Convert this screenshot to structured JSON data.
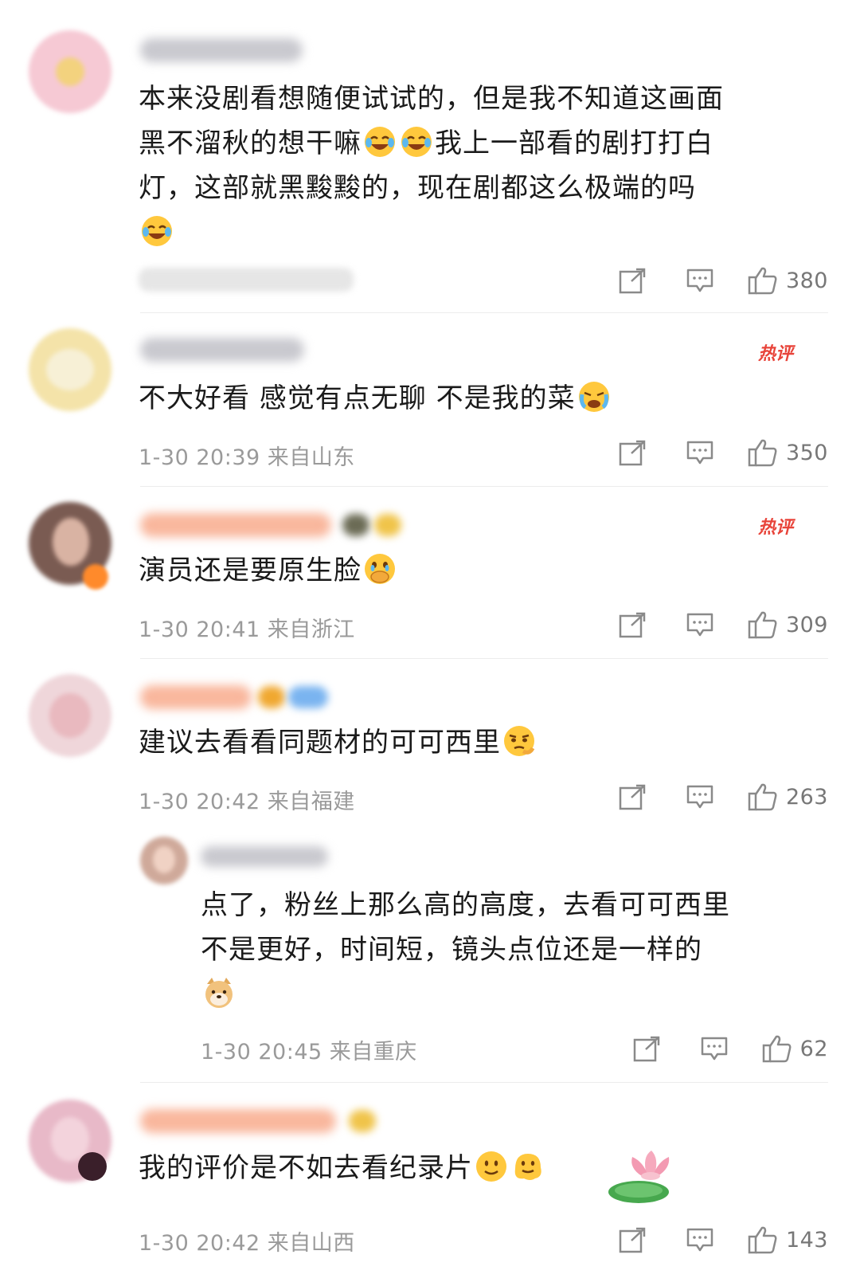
{
  "actions": {
    "share": "share-icon",
    "reply": "comment-icon",
    "like": "thumbs-up-icon"
  },
  "hot_label": "热评",
  "comments": [
    {
      "text_lines": [
        "本来没剧看想随便试试的，但是我不知道这画面",
        "黑不溜秋的想干嘛",
        "我上一部看的剧打打白",
        "灯，这部就黑黢黢的，现在剧都这么极端的吗"
      ],
      "meta": "",
      "likes": "380"
    },
    {
      "text": "不大好看 感觉有点无聊 不是我的菜",
      "meta": "1-30 20:39 来自山东",
      "likes": "350",
      "hot": true
    },
    {
      "text": "演员还是要原生脸",
      "meta": "1-30 20:41 来自浙江",
      "likes": "309",
      "hot": true
    },
    {
      "text": "建议去看看同题材的可可西里",
      "meta": "1-30 20:42 来自福建",
      "likes": "263"
    },
    {
      "reply": true,
      "text_lines": [
        "点了，粉丝上那么高的高度，去看可可西里",
        "不是更好，时间短，镜头点位还是一样的"
      ],
      "meta": "1-30 20:45 来自重庆",
      "likes": "62"
    },
    {
      "text": "我的评价是不如去看纪录片",
      "meta": "1-30 20:42 来自山西",
      "likes": "143"
    }
  ],
  "colors": {
    "hot": "#e8443a",
    "meta": "#9a9a9a",
    "text": "#1a1a1a"
  }
}
